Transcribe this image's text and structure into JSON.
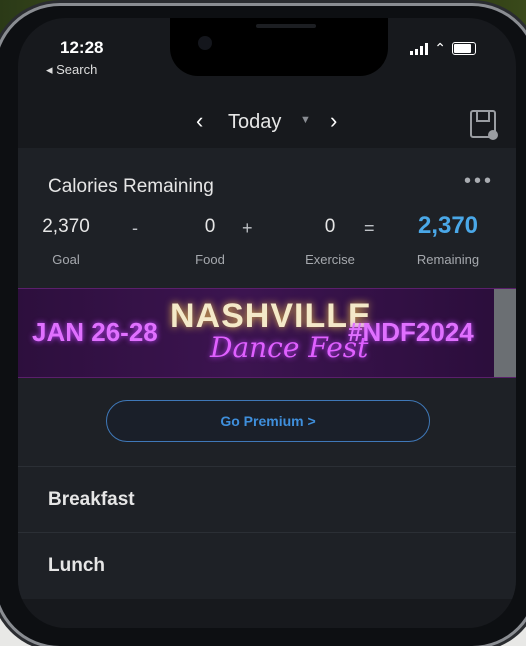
{
  "status_bar": {
    "time": "12:28",
    "back_label": "◂ Search"
  },
  "date_nav": {
    "title": "Today"
  },
  "calories": {
    "title": "Calories Remaining",
    "goal": {
      "value": "2,370",
      "label": "Goal"
    },
    "food": {
      "value": "0",
      "label": "Food"
    },
    "exercise": {
      "value": "0",
      "label": "Exercise"
    },
    "remaining": {
      "value": "2,370",
      "label": "Remaining"
    },
    "op_minus": "-",
    "op_plus": "+",
    "op_equals": "="
  },
  "ad_banner": {
    "date_text": "JAN 26-28",
    "title": "NASHVILLE",
    "subtitle": "Dance Fest",
    "hashtag": "#NDF2024"
  },
  "premium": {
    "label": "Go Premium >"
  },
  "meals": [
    "Breakfast",
    "Lunch"
  ],
  "colors": {
    "accent": "#4aa8e8",
    "background": "#17191d",
    "card": "#1e2126"
  }
}
